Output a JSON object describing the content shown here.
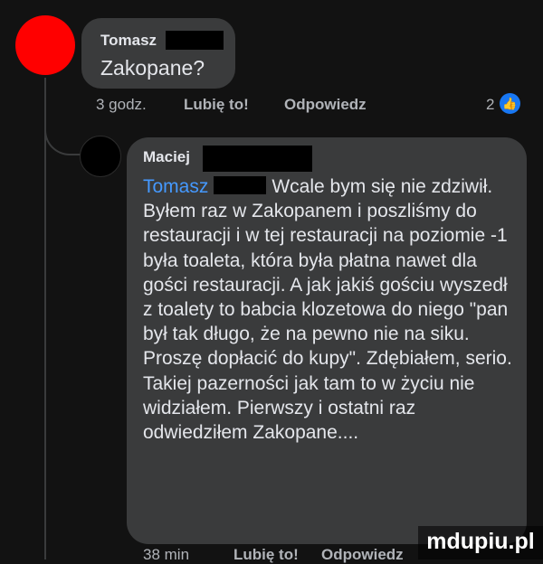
{
  "comment": {
    "author": "Tomasz",
    "text": "Zakopane?",
    "time": "3 godz.",
    "like_label": "Lubię to!",
    "reply_label": "Odpowiedz",
    "reaction_count": "2"
  },
  "reply": {
    "author": "Maciej",
    "mention": "Tomasz",
    "text_after_mention": "Wcale bym się nie zdziwił. Byłem raz w Zakopanem i poszliśmy do restauracji i w tej restauracji na poziomie -1 była toaleta, która była płatna nawet dla gości restauracji. A jak jakiś gościu wyszedł z toalety to babcia klozetowa do niego \"pan był tak długo, że na pewno nie na siku. Proszę dopłacić do kupy\". Zdębiałem, serio. Takiej pazerności jak tam to w życiu nie widziałem. Pierwszy i ostatni raz odwiedziłem Zakopane....",
    "time": "38 min",
    "like_label": "Lubię to!",
    "reply_label": "Odpowiedz"
  },
  "watermark": "mdupiu.pl",
  "colors": {
    "background": "#121212",
    "bubble": "#3a3b3c",
    "mention": "#4599ff",
    "like_icon": "#1877f2",
    "avatar_1": "#ff0000",
    "avatar_2": "#000000"
  }
}
